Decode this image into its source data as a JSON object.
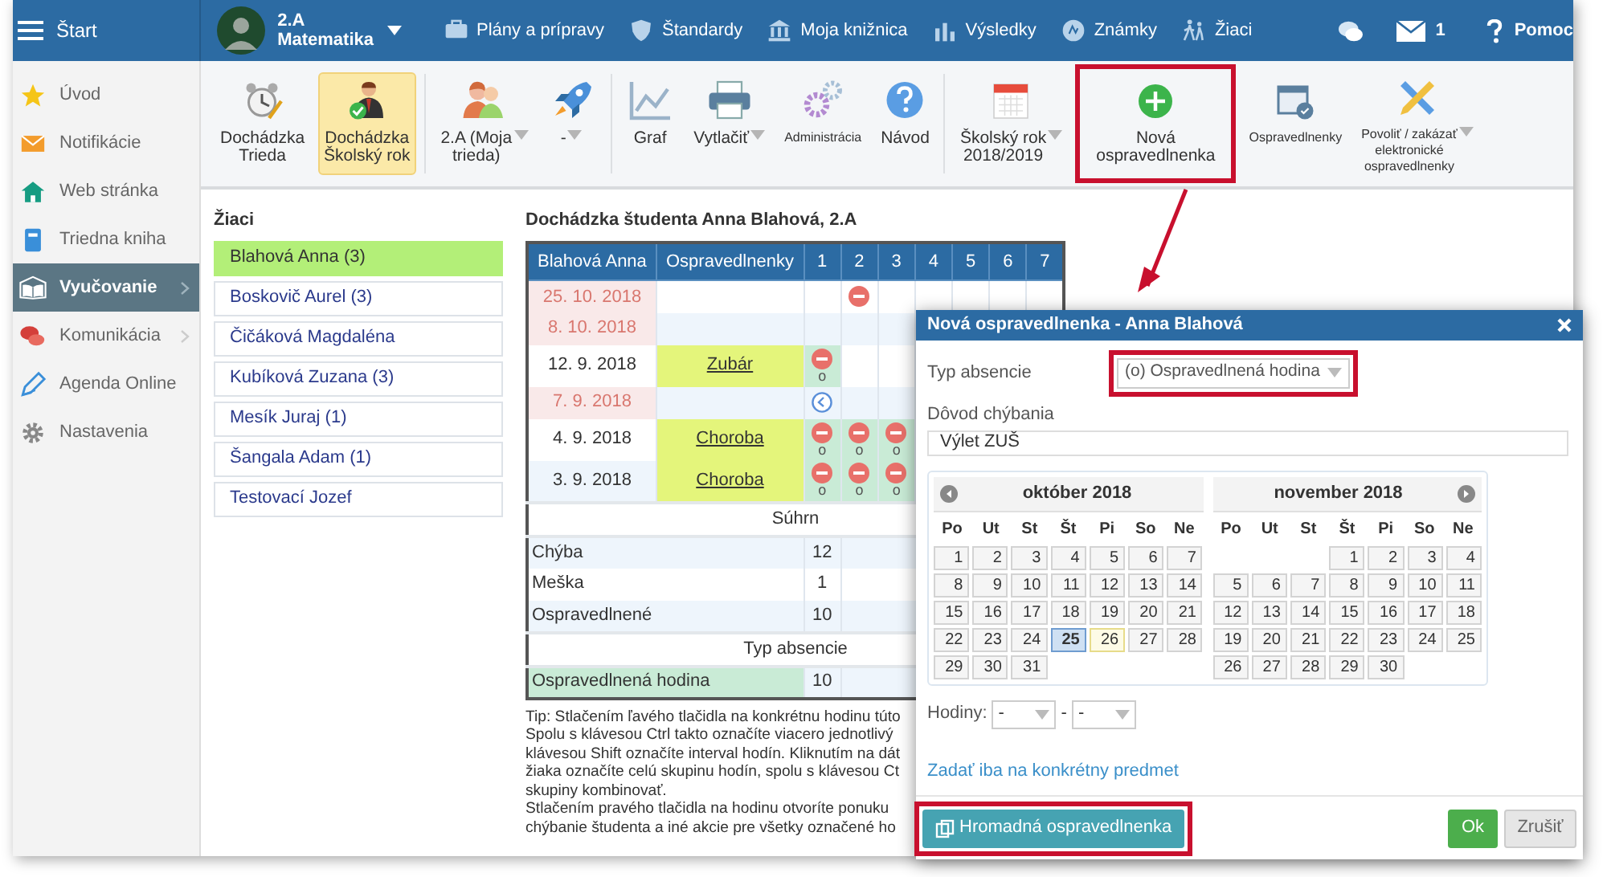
{
  "topbar": {
    "start_label": "Štart",
    "class_name": "2.A",
    "subject": "Matematika",
    "nav": [
      {
        "label": "Plány a prípravy"
      },
      {
        "label": "Štandardy"
      },
      {
        "label": "Moja knižnica"
      },
      {
        "label": "Výsledky"
      },
      {
        "label": "Známky"
      },
      {
        "label": "Žiaci"
      }
    ],
    "messages_count": "1",
    "help_label": "Pomoc"
  },
  "sidebar": {
    "items": [
      {
        "label": "Úvod",
        "selected": false,
        "submenu": false
      },
      {
        "label": "Notifikácie",
        "selected": false,
        "submenu": false
      },
      {
        "label": "Web stránka",
        "selected": false,
        "submenu": false
      },
      {
        "label": "Triedna kniha",
        "selected": false,
        "submenu": false
      },
      {
        "label": "Vyučovanie",
        "selected": true,
        "submenu": true
      },
      {
        "label": "Komunikácia",
        "selected": false,
        "submenu": true
      },
      {
        "label": "Agenda Online",
        "selected": false,
        "submenu": false
      },
      {
        "label": "Nastavenia",
        "selected": false,
        "submenu": false
      }
    ]
  },
  "toolbar": {
    "items": [
      {
        "kind": "button",
        "label": "Dochádzka\nTrieda",
        "selected": false,
        "dropdown": false,
        "highlighted": false
      },
      {
        "kind": "button",
        "label": "Dochádzka\nŠkolský rok",
        "selected": true,
        "dropdown": false,
        "highlighted": false
      },
      {
        "kind": "separator"
      },
      {
        "kind": "button",
        "label": "2.A (Moja\ntrieda)",
        "selected": false,
        "dropdown": true,
        "highlighted": false
      },
      {
        "kind": "button",
        "label": "-",
        "selected": false,
        "dropdown": true,
        "highlighted": false
      },
      {
        "kind": "separator"
      },
      {
        "kind": "button",
        "label": "Graf",
        "selected": false,
        "dropdown": false,
        "highlighted": false
      },
      {
        "kind": "button",
        "label": "Vytlačiť",
        "selected": false,
        "dropdown": true,
        "highlighted": false
      },
      {
        "kind": "button",
        "label": "Administrácia",
        "selected": false,
        "dropdown": false,
        "highlighted": false
      },
      {
        "kind": "button",
        "label": "Návod",
        "selected": false,
        "dropdown": false,
        "highlighted": false
      },
      {
        "kind": "separator"
      },
      {
        "kind": "button",
        "label": "Školský rok\n2018/2019",
        "selected": false,
        "dropdown": true,
        "highlighted": false
      },
      {
        "kind": "button",
        "label": "Nová\nospravedlnenka",
        "selected": false,
        "dropdown": false,
        "highlighted": true
      },
      {
        "kind": "button",
        "label": "Ospravedlnenky",
        "selected": false,
        "dropdown": false,
        "highlighted": false
      },
      {
        "kind": "button",
        "label": "Povoliť / zakázať\nelektronické\nospravedlnenky",
        "selected": false,
        "dropdown": true,
        "highlighted": false
      }
    ]
  },
  "students": {
    "title": "Žiaci",
    "items": [
      {
        "label": "Blahová Anna (3)",
        "selected": true
      },
      {
        "label": "Boskovič Aurel (3)",
        "selected": false
      },
      {
        "label": "Čičáková Magdaléna",
        "selected": false
      },
      {
        "label": "Kubíková Zuzana (3)",
        "selected": false
      },
      {
        "label": "Mesík Juraj (1)",
        "selected": false
      },
      {
        "label": "Šangala Adam (1)",
        "selected": false
      },
      {
        "label": "Testovací Jozef",
        "selected": false
      }
    ]
  },
  "attendance": {
    "title": "Dochádzka študenta Anna Blahová, 2.A",
    "columns": [
      "Blahová Anna",
      "Ospravedlnenky",
      "1",
      "2",
      "3",
      "4",
      "5",
      "6",
      "7"
    ],
    "rows": [
      {
        "date": "25. 10. 2018",
        "highlighted": true,
        "hours": [
          {
            "kind": "none"
          },
          {
            "kind": "absent",
            "excused": false
          },
          {
            "kind": "none"
          },
          {
            "kind": "none"
          },
          {
            "kind": "none"
          },
          {
            "kind": "none"
          },
          {
            "kind": "none"
          }
        ]
      },
      {
        "date": "8. 10. 2018",
        "highlighted": true,
        "hours": [
          {
            "kind": "none"
          },
          {
            "kind": "none"
          },
          {
            "kind": "none"
          }
        ]
      },
      {
        "date": "12. 9. 2018",
        "highlighted": false,
        "excuse": "Zubár",
        "hours": [
          {
            "kind": "absent",
            "excused": true,
            "code": "o"
          },
          {
            "kind": "none"
          },
          {
            "kind": "none"
          }
        ]
      },
      {
        "date": "7. 9. 2018",
        "highlighted": true,
        "hours": [
          {
            "kind": "late",
            "excused": false
          },
          {
            "kind": "none"
          },
          {
            "kind": "none"
          }
        ]
      },
      {
        "date": "4. 9. 2018",
        "highlighted": false,
        "excuse": "Choroba",
        "hours": [
          {
            "kind": "absent",
            "excused": true,
            "code": "o"
          },
          {
            "kind": "absent",
            "excused": true,
            "code": "o"
          },
          {
            "kind": "absent",
            "excused": true,
            "code": "o"
          }
        ]
      },
      {
        "date": "3. 9. 2018",
        "highlighted": false,
        "excuse": "Choroba",
        "hours": [
          {
            "kind": "absent",
            "excused": true,
            "code": "o"
          },
          {
            "kind": "absent",
            "excused": true,
            "code": "o"
          },
          {
            "kind": "absent",
            "excused": true,
            "code": "o"
          }
        ]
      }
    ],
    "summary_title": "Súhrn",
    "summary": [
      {
        "label": "Chýba",
        "value": "12"
      },
      {
        "label": "Meška",
        "value": "1"
      },
      {
        "label": "Ospravedlnené",
        "value": "10"
      }
    ],
    "types_title": "Typ absencie",
    "types": [
      {
        "label": "Ospravedlnená hodina",
        "value": "10"
      }
    ]
  },
  "tip": [
    "Tip: Stlačením ľavého tlačidla na konkrétnu hodinu túto",
    "Spolu s klávesou Ctrl takto označíte viacero jednotlivý",
    "klávesou Shift označíte interval hodín. Kliknutím na dát",
    "žiaka označíte celú skupinu hodín, spolu s klávesou Ct",
    "skupiny kombinovať.",
    "Stlačením pravého tlačidla na hodinu otvoríte ponuku",
    "chýbanie študenta a iné akcie pre všetky označené ho"
  ],
  "dialog": {
    "title": "Nová ospravedlnenka - Anna Blahová",
    "type_label": "Typ absencie",
    "type_value": "(o) Ospravedlnená hodina",
    "type_highlighted": true,
    "reason_label": "Dôvod chýbania",
    "reason_value": "Výlet ZUŠ",
    "months": [
      {
        "title": "október 2018",
        "weekdays": [
          "Po",
          "Ut",
          "St",
          "Št",
          "Pi",
          "So",
          "Ne"
        ],
        "weeks": [
          [
            {
              "kind": "day",
              "label": "1",
              "selected": false,
              "today": false
            },
            {
              "kind": "day",
              "label": "2",
              "selected": false,
              "today": false
            },
            {
              "kind": "day",
              "label": "3",
              "selected": false,
              "today": false
            },
            {
              "kind": "day",
              "label": "4",
              "selected": false,
              "today": false
            },
            {
              "kind": "day",
              "label": "5",
              "selected": false,
              "today": false
            },
            {
              "kind": "day",
              "label": "6",
              "selected": false,
              "today": false
            },
            {
              "kind": "day",
              "label": "7",
              "selected": false,
              "today": false
            }
          ],
          [
            {
              "kind": "day",
              "label": "8",
              "selected": false,
              "today": false
            },
            {
              "kind": "day",
              "label": "9",
              "selected": false,
              "today": false
            },
            {
              "kind": "day",
              "label": "10",
              "selected": false,
              "today": false
            },
            {
              "kind": "day",
              "label": "11",
              "selected": false,
              "today": false
            },
            {
              "kind": "day",
              "label": "12",
              "selected": false,
              "today": false
            },
            {
              "kind": "day",
              "label": "13",
              "selected": false,
              "today": false
            },
            {
              "kind": "day",
              "label": "14",
              "selected": false,
              "today": false
            }
          ],
          [
            {
              "kind": "day",
              "label": "15",
              "selected": false,
              "today": false
            },
            {
              "kind": "day",
              "label": "16",
              "selected": false,
              "today": false
            },
            {
              "kind": "day",
              "label": "17",
              "selected": false,
              "today": false
            },
            {
              "kind": "day",
              "label": "18",
              "selected": false,
              "today": false
            },
            {
              "kind": "day",
              "label": "19",
              "selected": false,
              "today": false
            },
            {
              "kind": "day",
              "label": "20",
              "selected": false,
              "today": false
            },
            {
              "kind": "day",
              "label": "21",
              "selected": false,
              "today": false
            }
          ],
          [
            {
              "kind": "day",
              "label": "22",
              "selected": false,
              "today": false
            },
            {
              "kind": "day",
              "label": "23",
              "selected": false,
              "today": false
            },
            {
              "kind": "day",
              "label": "24",
              "selected": false,
              "today": false
            },
            {
              "kind": "day",
              "label": "25",
              "selected": true,
              "today": false
            },
            {
              "kind": "day",
              "label": "26",
              "selected": false,
              "today": true
            },
            {
              "kind": "day",
              "label": "27",
              "selected": false,
              "today": false
            },
            {
              "kind": "day",
              "label": "28",
              "selected": false,
              "today": false
            }
          ],
          [
            {
              "kind": "day",
              "label": "29",
              "selected": false,
              "today": false
            },
            {
              "kind": "day",
              "label": "30",
              "selected": false,
              "today": false
            },
            {
              "kind": "day",
              "label": "31",
              "selected": false,
              "today": false
            }
          ]
        ]
      },
      {
        "title": "november 2018",
        "weekdays": [
          "Po",
          "Ut",
          "St",
          "Št",
          "Pi",
          "So",
          "Ne"
        ],
        "weeks": [
          [
            {
              "kind": "blank"
            },
            {
              "kind": "blank"
            },
            {
              "kind": "blank"
            },
            {
              "kind": "day",
              "label": "1",
              "selected": false,
              "today": false
            },
            {
              "kind": "day",
              "label": "2",
              "selected": false,
              "today": false
            },
            {
              "kind": "day",
              "label": "3",
              "selected": false,
              "today": false
            },
            {
              "kind": "day",
              "label": "4",
              "selected": false,
              "today": false
            }
          ],
          [
            {
              "kind": "day",
              "label": "5",
              "selected": false,
              "today": false
            },
            {
              "kind": "day",
              "label": "6",
              "selected": false,
              "today": false
            },
            {
              "kind": "day",
              "label": "7",
              "selected": false,
              "today": false
            },
            {
              "kind": "day",
              "label": "8",
              "selected": false,
              "today": false
            },
            {
              "kind": "day",
              "label": "9",
              "selected": false,
              "today": false
            },
            {
              "kind": "day",
              "label": "10",
              "selected": false,
              "today": false
            },
            {
              "kind": "day",
              "label": "11",
              "selected": false,
              "today": false
            }
          ],
          [
            {
              "kind": "day",
              "label": "12",
              "selected": false,
              "today": false
            },
            {
              "kind": "day",
              "label": "13",
              "selected": false,
              "today": false
            },
            {
              "kind": "day",
              "label": "14",
              "selected": false,
              "today": false
            },
            {
              "kind": "day",
              "label": "15",
              "selected": false,
              "today": false
            },
            {
              "kind": "day",
              "label": "16",
              "selected": false,
              "today": false
            },
            {
              "kind": "day",
              "label": "17",
              "selected": false,
              "today": false
            },
            {
              "kind": "day",
              "label": "18",
              "selected": false,
              "today": false
            }
          ],
          [
            {
              "kind": "day",
              "label": "19",
              "selected": false,
              "today": false
            },
            {
              "kind": "day",
              "label": "20",
              "selected": false,
              "today": false
            },
            {
              "kind": "day",
              "label": "21",
              "selected": false,
              "today": false
            },
            {
              "kind": "day",
              "label": "22",
              "selected": false,
              "today": false
            },
            {
              "kind": "day",
              "label": "23",
              "selected": false,
              "today": false
            },
            {
              "kind": "day",
              "label": "24",
              "selected": false,
              "today": false
            },
            {
              "kind": "day",
              "label": "25",
              "selected": false,
              "today": false
            }
          ],
          [
            {
              "kind": "day",
              "label": "26",
              "selected": false,
              "today": false
            },
            {
              "kind": "day",
              "label": "27",
              "selected": false,
              "today": false
            },
            {
              "kind": "day",
              "label": "28",
              "selected": false,
              "today": false
            },
            {
              "kind": "day",
              "label": "29",
              "selected": false,
              "today": false
            },
            {
              "kind": "day",
              "label": "30",
              "selected": false,
              "today": false
            }
          ]
        ]
      }
    ],
    "hours_label": "Hodiny:",
    "hours_from": "-",
    "hours_to": "-",
    "hours_separator": "-",
    "subject_link": "Zadať iba na konkrétny predmet",
    "bulk_button": "Hromadná ospravedlnenka",
    "bulk_highlighted": true,
    "ok_button": "Ok",
    "cancel_button": "Zrušiť"
  }
}
